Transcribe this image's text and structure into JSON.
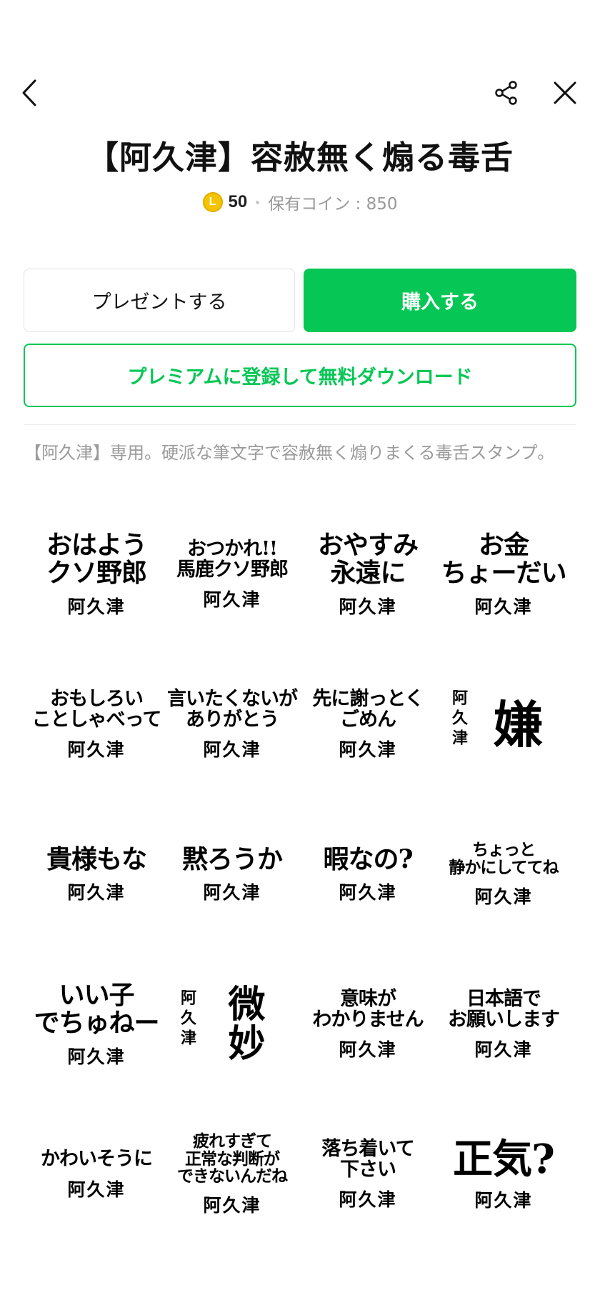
{
  "header": {
    "back_icon": "chevron-left-icon",
    "share_icon": "share-icon",
    "close_icon": "close-icon"
  },
  "product": {
    "title": "【阿久津】容赦無く煽る毒舌",
    "coin_symbol": "L",
    "price": "50",
    "balance": "保有コイン : 850",
    "description": "【阿久津】専用。硬派な筆文字で容赦無く煽りまくる毒舌スタンプ。"
  },
  "actions": {
    "present_label": "プレゼントする",
    "buy_label": "購入する",
    "premium_label": "プレミアムに登録して無料ダウンロード"
  },
  "colors": {
    "accent": "#06c755",
    "coin": "#f5c400",
    "muted_text": "#9a9a9a"
  },
  "stickers": [
    {
      "text": "おはよう\nクソ野郎",
      "signature": "阿久津"
    },
    {
      "text": "おつかれ!!\n馬鹿クソ野郎",
      "signature": "阿久津"
    },
    {
      "text": "おやすみ\n永遠に",
      "signature": "阿久津"
    },
    {
      "text": "お金\nちょーだい",
      "signature": "阿久津"
    },
    {
      "text": "おもしろい\nことしゃべって",
      "signature": "阿久津"
    },
    {
      "text": "言いたくないが\nありがとう",
      "signature": "阿久津"
    },
    {
      "text": "先に謝っとく\nごめん",
      "signature": "阿久津"
    },
    {
      "text": "嫌",
      "signature": "阿久津"
    },
    {
      "text": "貴様もな",
      "signature": "阿久津"
    },
    {
      "text": "黙ろうか",
      "signature": "阿久津"
    },
    {
      "text": "暇なの?",
      "signature": "阿久津"
    },
    {
      "text": "ちょっと\n静かにしててね",
      "signature": "阿久津"
    },
    {
      "text": "いい子\nでちゅねー",
      "signature": "阿久津"
    },
    {
      "text": "微\n妙",
      "signature": "阿久津"
    },
    {
      "text": "意味が\nわかりません",
      "signature": "阿久津"
    },
    {
      "text": "日本語で\nお願いします",
      "signature": "阿久津"
    },
    {
      "text": "かわいそうに",
      "signature": "阿久津"
    },
    {
      "text": "疲れすぎて\n正常な判断が\nできないんだね",
      "signature": "阿久津"
    },
    {
      "text": "落ち着いて\n下さい",
      "signature": "阿久津"
    },
    {
      "text": "正気?",
      "signature": "阿久津"
    }
  ]
}
